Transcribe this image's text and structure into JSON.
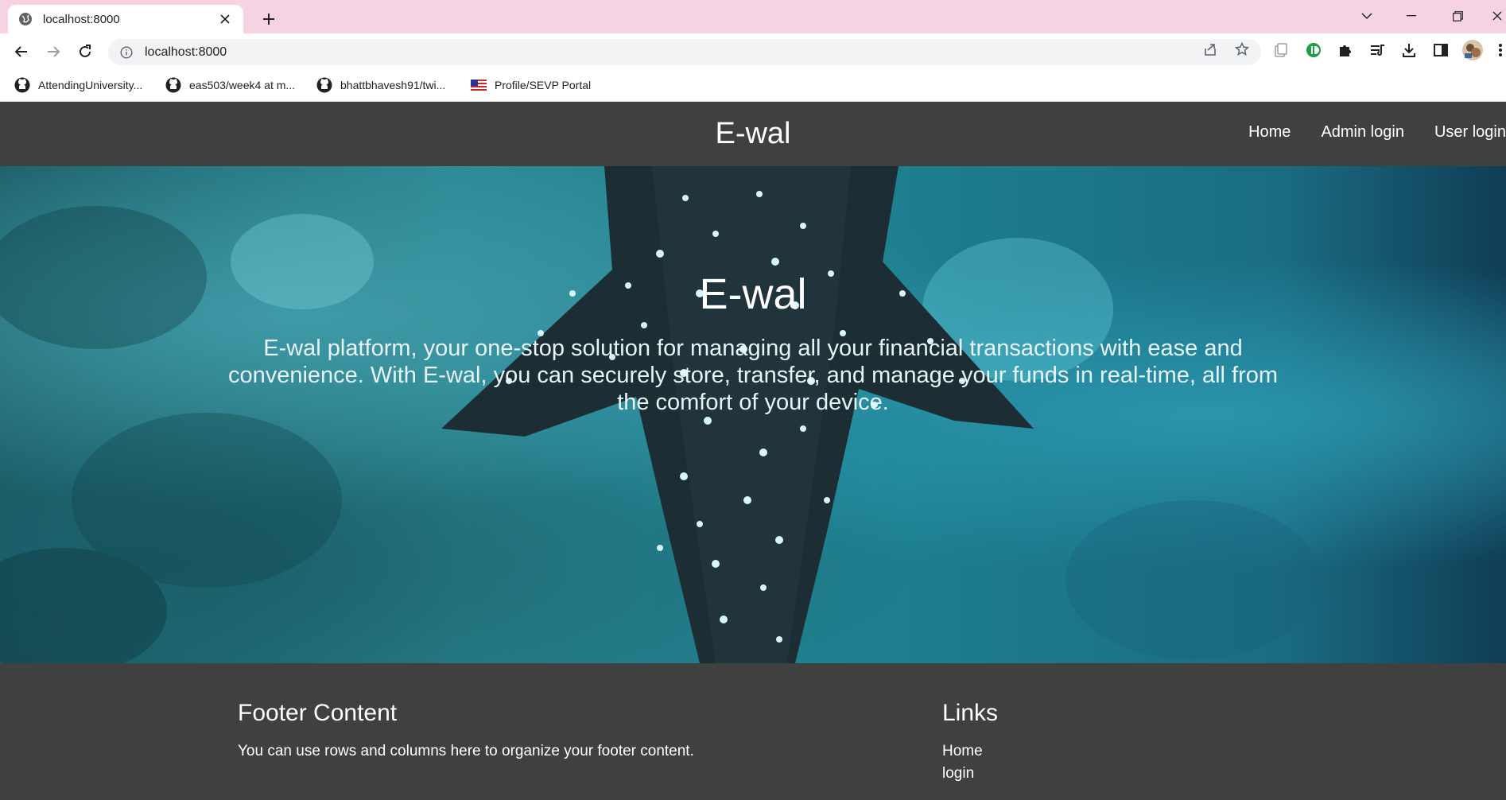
{
  "browser": {
    "tab": {
      "title": "localhost:8000"
    },
    "address_bar": {
      "url": "localhost:8000"
    },
    "bookmarks": [
      {
        "label": "AttendingUniversity...",
        "icon": "github-icon"
      },
      {
        "label": "eas503/week4 at m...",
        "icon": "github-icon"
      },
      {
        "label": "bhattbhavesh91/twi...",
        "icon": "github-icon"
      },
      {
        "label": "Profile/SEVP Portal",
        "icon": "us-flag-icon"
      }
    ]
  },
  "site": {
    "brand": "E-wal",
    "nav": [
      {
        "label": "Home"
      },
      {
        "label": "Admin login"
      },
      {
        "label": "User login"
      }
    ],
    "hero": {
      "title": "E-wal",
      "text": "E-wal platform, your one-stop solution for managing all your financial transactions with ease and convenience. With E-wal, you can securely store, transfer, and manage your funds in real-time, all from the comfort of your device."
    },
    "footer": {
      "content_title": "Footer Content",
      "content_text": "You can use rows and columns here to organize your footer content.",
      "links_title": "Links",
      "links": [
        {
          "label": "Home"
        },
        {
          "label": "login"
        }
      ]
    }
  },
  "colors": {
    "tabstrip": "#f6d3e3",
    "navbar": "#404040",
    "footer": "#404040",
    "hero_teal": "#2a8792"
  }
}
